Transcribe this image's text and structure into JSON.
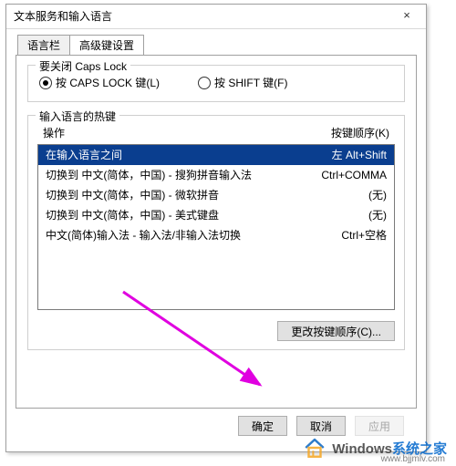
{
  "window": {
    "title": "文本服务和输入语言",
    "close": "×"
  },
  "tabs": {
    "tab1": "语言栏",
    "tab2": "高级键设置"
  },
  "capslock": {
    "legend": "要关闭 Caps Lock",
    "opt1": "按 CAPS LOCK 键(L)",
    "opt2": "按 SHIFT 键(F)"
  },
  "hotkeys": {
    "legend": "输入语言的热键",
    "col_action": "操作",
    "col_keys": "按键顺序(K)",
    "rows": [
      {
        "action": "在输入语言之间",
        "keys": "左 Alt+Shift"
      },
      {
        "action": "切换到 中文(简体，中国) - 搜狗拼音输入法",
        "keys": "Ctrl+COMMA"
      },
      {
        "action": "切换到 中文(简体，中国) - 微软拼音",
        "keys": "(无)"
      },
      {
        "action": "切换到 中文(简体，中国) - 美式键盘",
        "keys": "(无)"
      },
      {
        "action": "中文(简体)输入法 - 输入法/非输入法切换",
        "keys": "Ctrl+空格"
      }
    ],
    "change_btn": "更改按键顺序(C)..."
  },
  "buttons": {
    "ok": "确定",
    "cancel": "取消",
    "apply": "应用"
  },
  "watermark": {
    "brand_en": "Windows",
    "brand_zh": "系统之家",
    "url": "www.bjjmlv.com"
  }
}
